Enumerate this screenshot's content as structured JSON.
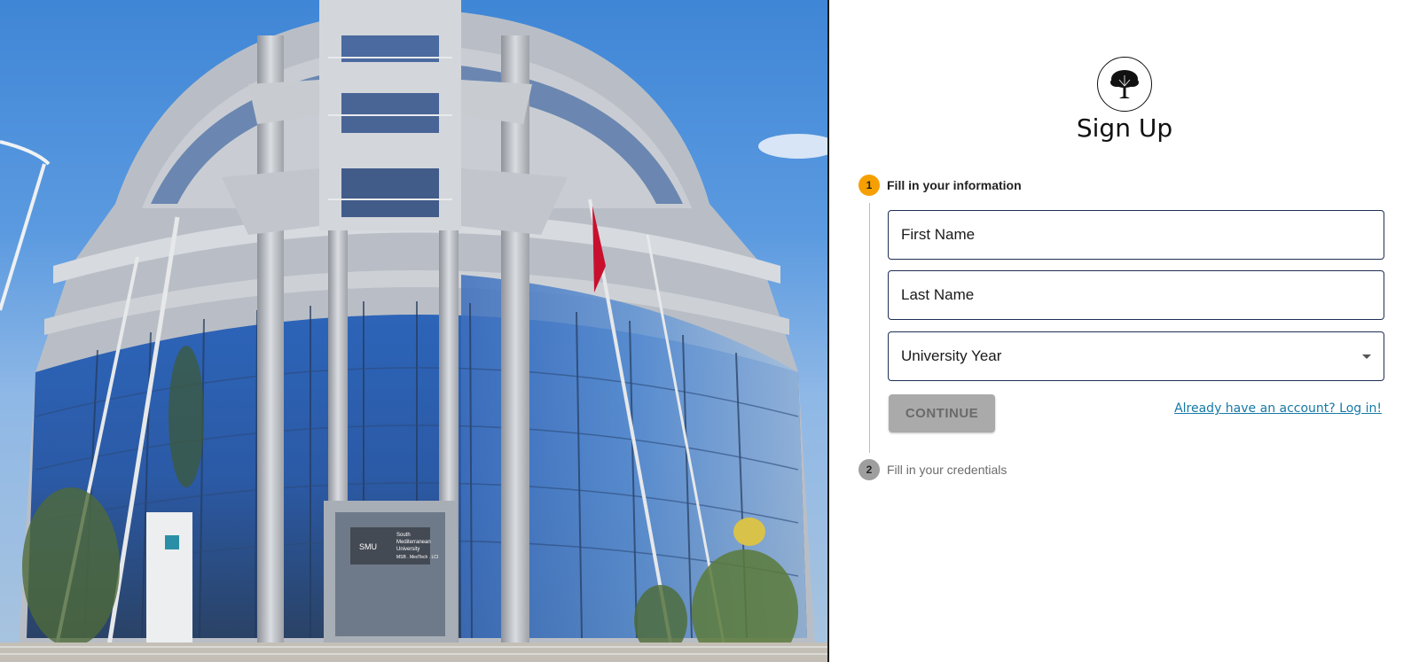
{
  "hero": {
    "image_alt": "Campus building with glass facade",
    "sign_lines": [
      "SMU",
      "South",
      "Mediterranean",
      "University",
      "MSB . MedTech . LCI"
    ]
  },
  "header": {
    "logo_icon": "tree-icon",
    "title": "Sign Up"
  },
  "stepper": {
    "steps": [
      {
        "number": "1",
        "label": "Fill in your information",
        "state": "active",
        "color": "#f5a000"
      },
      {
        "number": "2",
        "label": "Fill in your credentials",
        "state": "inactive",
        "color": "#9e9e9e"
      }
    ]
  },
  "form": {
    "first_name_placeholder": "First Name",
    "last_name_placeholder": "Last Name",
    "university_year_label": "University Year",
    "continue_label": "CONTINUE",
    "login_link": "Already have an account? Log in!"
  },
  "colors": {
    "accent": "#f5a000",
    "field_border": "#1f2f55",
    "link": "#1679a6",
    "disabled_button": "#aaaaaa"
  }
}
